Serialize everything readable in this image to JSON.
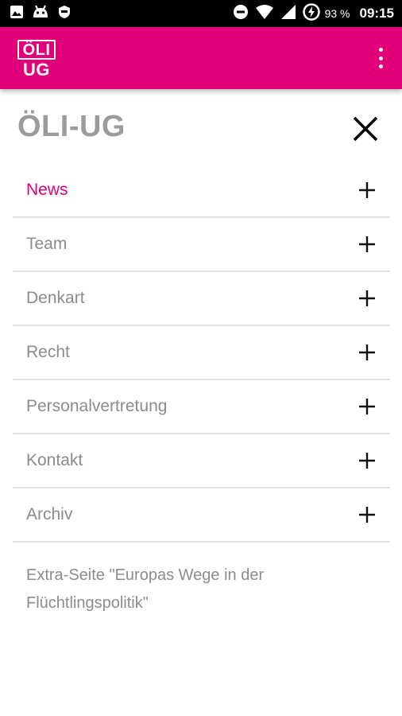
{
  "theme": {
    "accent": "#e2007a",
    "text_gray": "#8c8c8c"
  },
  "status_bar": {
    "battery": "93 %",
    "time": "09:15"
  },
  "app_bar": {
    "logo_line1": "ÖLI",
    "logo_line2": "UG"
  },
  "menu": {
    "title": "ÖLI-UG",
    "items": [
      {
        "label": "News"
      },
      {
        "label": "Team"
      },
      {
        "label": "Denkart"
      },
      {
        "label": "Recht"
      },
      {
        "label": "Personalvertretung"
      },
      {
        "label": "Kontakt"
      },
      {
        "label": "Archiv"
      }
    ],
    "extra_link": "Extra-Seite \"Europas Wege in der Flüchtlingspolitik\""
  }
}
